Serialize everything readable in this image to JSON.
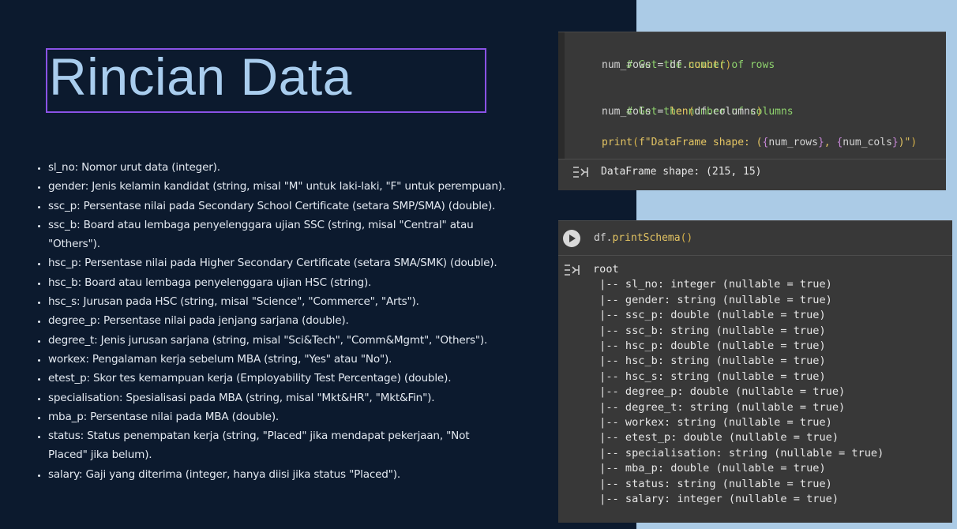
{
  "slide": {
    "title": "Rincian Data",
    "fields": [
      "sl_no: Nomor urut data (integer).",
      "gender: Jenis kelamin kandidat (string, misal \"M\" untuk laki-laki, \"F\" untuk perempuan).",
      "ssc_p: Persentase nilai pada Secondary School Certificate (setara SMP/SMA) (double).",
      "ssc_b: Board atau lembaga penyelenggara ujian SSC (string, misal \"Central\" atau \"Others\").",
      "hsc_p: Persentase nilai pada Higher Secondary Certificate (setara SMA/SMK) (double).",
      "hsc_b: Board atau lembaga penyelenggara ujian HSC (string).",
      "hsc_s: Jurusan pada HSC (string, misal \"Science\", \"Commerce\", \"Arts\").",
      "degree_p: Persentase nilai pada jenjang sarjana (double).",
      "degree_t: Jenis jurusan sarjana (string, misal \"Sci&Tech\", \"Comm&Mgmt\", \"Others\").",
      "workex: Pengalaman kerja sebelum MBA (string, \"Yes\" atau \"No\").",
      "etest_p: Skor tes kemampuan kerja (Employability Test Percentage) (double).",
      "specialisation: Spesialisasi pada MBA (string, misal \"Mkt&HR\", \"Mkt&Fin\").",
      "mba_p: Persentase nilai pada MBA (double).",
      "status: Status penempatan kerja (string, \"Placed\" jika mendapat pekerjaan, \"Not Placed\" jika belum).",
      "salary: Gaji yang diterima (integer, hanya diisi jika status \"Placed\")."
    ]
  },
  "cell1": {
    "comment_rows": "# Get the number of rows",
    "rows_var": "num_rows",
    "rows_eq": " = df.",
    "rows_fn": "count",
    "comment_cols": "# Get the number of columns",
    "cols_var": "num_cols",
    "cols_eq": " = ",
    "cols_fn": "len",
    "cols_arg": "df.columns",
    "print_fn": "print",
    "print_str_a": "f\"DataFrame shape: (",
    "print_var_a": "num_rows",
    "print_str_b": ", ",
    "print_var_b": "num_cols",
    "print_str_c": ")\"",
    "output": "DataFrame shape: (215, 15)"
  },
  "cell2": {
    "code_obj": "df.",
    "code_fn": "printSchema",
    "output_root": "root",
    "schema_lines": [
      " |-- sl_no: integer (nullable = true)",
      " |-- gender: string (nullable = true)",
      " |-- ssc_p: double (nullable = true)",
      " |-- ssc_b: string (nullable = true)",
      " |-- hsc_p: double (nullable = true)",
      " |-- hsc_b: string (nullable = true)",
      " |-- hsc_s: string (nullable = true)",
      " |-- degree_p: double (nullable = true)",
      " |-- degree_t: string (nullable = true)",
      " |-- workex: string (nullable = true)",
      " |-- etest_p: double (nullable = true)",
      " |-- specialisation: string (nullable = true)",
      " |-- mba_p: double (nullable = true)",
      " |-- status: string (nullable = true)",
      " |-- salary: integer (nullable = true)"
    ]
  },
  "colors": {
    "background": "#0c1a2e",
    "title_text": "#a9cdee",
    "title_border": "#8a52e6",
    "right_band": "#abcbe6",
    "cell_bg": "#383838",
    "comment": "#8fd36e",
    "function": "#e3c463"
  },
  "icons": {
    "output_icon": "output-toggle-icon",
    "run_icon": "play-icon"
  }
}
